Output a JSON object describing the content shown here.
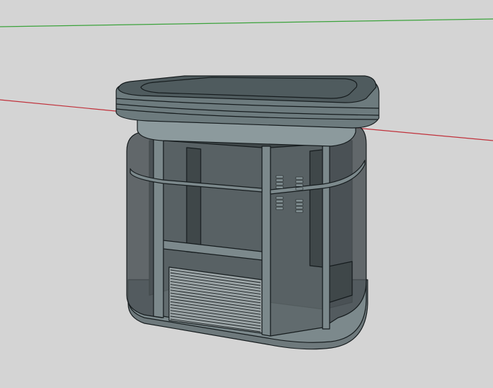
{
  "viewport": {
    "background_color": "#d4d4d4",
    "axes": {
      "green_axis_color": "#3aa23a",
      "red_axis_color": "#c0303a"
    }
  },
  "model": {
    "colors": {
      "edge": "#161c1e",
      "roof_top": "#4f5b5e",
      "roof_band": "#6d7b7e",
      "roof_under": "#8c9a9d",
      "glass_front": "#5d6669",
      "glass_side": "#4c5457",
      "interior": "#3f4749",
      "frame": "#7c898c",
      "base": "#6e797c",
      "shutter": "#9aa3a5"
    }
  }
}
